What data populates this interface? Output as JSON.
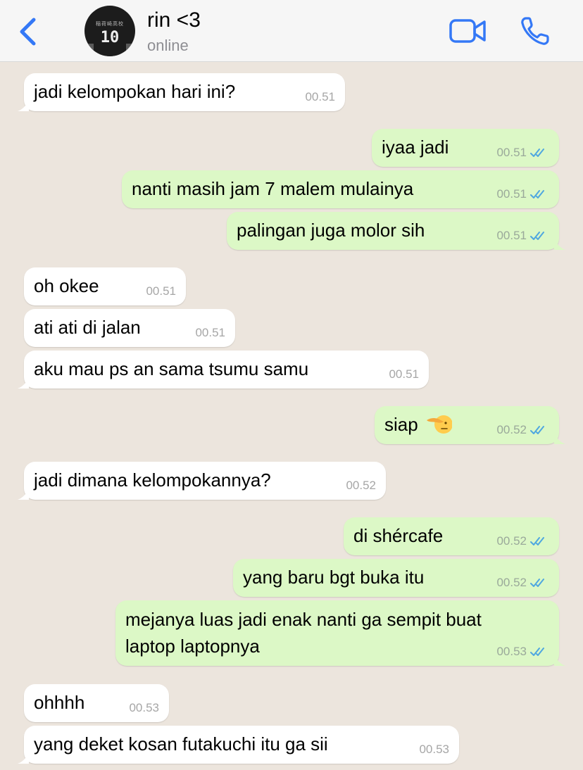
{
  "header": {
    "contact_name": "rin <3",
    "status": "online",
    "avatar_jersey_text": "稲荷崎高校",
    "avatar_jersey_number": "10"
  },
  "icons": {
    "back": "chevron-left-icon",
    "video": "video-camera-icon",
    "call": "phone-icon",
    "read_receipt": "double-check-icon"
  },
  "colors": {
    "accent": "#3478f6",
    "background": "#ece5dd",
    "incoming_bubble": "#ffffff",
    "outgoing_bubble": "#dcf8c6",
    "read_tick": "#4fa7e0"
  },
  "messages": [
    {
      "dir": "in",
      "text": "jadi kelompokan hari ini?",
      "time": "00.51"
    },
    {
      "dir": "out",
      "text": "iyaa jadi",
      "time": "00.51"
    },
    {
      "dir": "out",
      "text": "nanti masih jam 7 malem mulainya",
      "time": "00.51"
    },
    {
      "dir": "out",
      "text": "palingan juga molor sih",
      "time": "00.51"
    },
    {
      "dir": "in",
      "text": "oh okee",
      "time": "00.51"
    },
    {
      "dir": "in",
      "text": "ati ati di jalan",
      "time": "00.51"
    },
    {
      "dir": "in",
      "text": "aku mau ps an sama tsumu samu",
      "time": "00.51"
    },
    {
      "dir": "out",
      "text": "siap",
      "emoji": "saluting-face",
      "time": "00.52"
    },
    {
      "dir": "in",
      "text": "jadi dimana kelompokannya?",
      "time": "00.52"
    },
    {
      "dir": "out",
      "text": "di shércafe",
      "time": "00.52"
    },
    {
      "dir": "out",
      "text": "yang baru bgt buka itu",
      "time": "00.52"
    },
    {
      "dir": "out",
      "text_line1": "mejanya luas jadi enak nanti ga sempit buat",
      "text_line2": "laptop laptopnya",
      "time": "00.53"
    },
    {
      "dir": "in",
      "text": "ohhhh",
      "time": "00.53"
    },
    {
      "dir": "in",
      "text": "yang deket kosan futakuchi itu ga sii",
      "time": "00.53"
    }
  ]
}
